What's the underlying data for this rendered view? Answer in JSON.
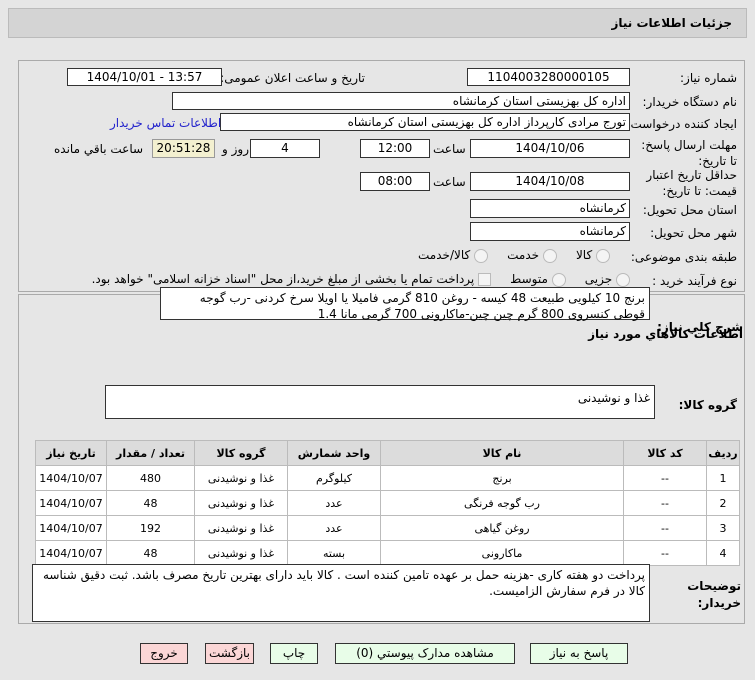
{
  "header": {
    "title": "جزئیات اطلاعات نیاز"
  },
  "form": {
    "need_number_label": "شماره نیاز:",
    "need_number": "1104003280000105",
    "announce_label": "تاریخ و ساعت اعلان عمومی:",
    "announce_value": "1404/10/01 - 13:57",
    "buyer_org_label": "نام دستگاه خریدار:",
    "buyer_org": "اداره کل بهزیستی استان کرمانشاه",
    "creator_label": "ایجاد کننده درخواست:",
    "creator": "تورج مرادی کارپرداز  اداره کل بهزیستی استان کرمانشاه",
    "contact_link": "اطلاعات تماس خریدار",
    "deadline_label": "مهلت ارسال پاسخ: تا تاریخ:",
    "deadline_date": "1404/10/06",
    "time_label": "ساعت",
    "deadline_time": "12:00",
    "days": "4",
    "days_label": "روز و",
    "countdown": "20:51:28",
    "remaining_label": "ساعت باقي مانده",
    "validity_label": "حداقل تاریخ اعتبار قیمت: تا تاریخ:",
    "validity_date": "1404/10/08",
    "validity_time": "08:00",
    "province_label": "استان محل تحویل:",
    "province": "کرمانشاه",
    "city_label": "شهر محل تحویل:",
    "city": "کرمانشاه",
    "category_label": "طبقه بندی موضوعی:",
    "category_options": [
      "کالا",
      "خدمت",
      "کالا/خدمت"
    ],
    "process_label": "نوع فرآیند خرید :",
    "process_options": [
      "جزیی",
      "متوسط"
    ],
    "payment_note": "پرداخت تمام یا بخشی از مبلغ خرید،از محل \"اسناد خزانه اسلامی\" خواهد بود."
  },
  "details": {
    "desc_label": "شرح کلي نياز:",
    "desc": "برنج  10 کیلویی طبیعت 48 کیسه - روغن 810 گرمی فامیلا یا اویلا سرخ کردنی -رب گوجه قوطی کنسروی 800 گرم چین چین-ماکارونی 700 گرمی مانا 1.4",
    "goods_info_title": "اطلاعات کالاهاي مورد نياز",
    "group_label": "گروه کالا:",
    "group": "غذا و نوشیدنی",
    "table": {
      "headers": [
        "ردیف",
        "کد کالا",
        "نام کالا",
        "واحد شمارش",
        "گروه کالا",
        "تعداد / مقدار",
        "تاریخ نیاز"
      ],
      "rows": [
        [
          "1",
          "--",
          "برنج",
          "کیلوگرم",
          "غذا و نوشیدنی",
          "480",
          "1404/10/07"
        ],
        [
          "2",
          "--",
          "رب گوجه فرنگی",
          "عدد",
          "غذا و نوشیدنی",
          "48",
          "1404/10/07"
        ],
        [
          "3",
          "--",
          "روغن گیاهی",
          "عدد",
          "غذا و نوشیدنی",
          "192",
          "1404/10/07"
        ],
        [
          "4",
          "--",
          "ماکارونی",
          "بسته",
          "غذا و نوشیدنی",
          "48",
          "1404/10/07"
        ]
      ]
    },
    "notes_label": "توضیحات خریدار:",
    "notes": "پرداخت دو  هفته کاری -هزینه حمل بر عهده تامین کننده است . کالا باید دارای بهترین تاریخ مصرف باشد. ثبت دقیق شناسه کالا در فرم سفارش الزامیست."
  },
  "buttons": {
    "reply": "پاسخ به نیاز",
    "attachments": "مشاهده مدارک پیوستي (0)",
    "print": "چاپ",
    "back": "بازگشت",
    "exit": "خروج"
  }
}
